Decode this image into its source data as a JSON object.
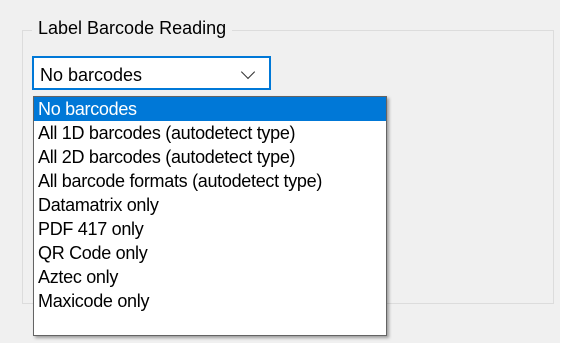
{
  "group": {
    "title": "Label Barcode Reading"
  },
  "combo": {
    "value": "No barcodes"
  },
  "dropdown": {
    "options": [
      "No barcodes",
      "All 1D barcodes (autodetect type)",
      "All 2D barcodes (autodetect type)",
      "All barcode formats (autodetect type)",
      "Datamatrix only",
      "PDF 417 only",
      "QR Code only",
      "Aztec only",
      "Maxicode only"
    ],
    "selected_index": 0
  },
  "colors": {
    "accent": "#0078d7",
    "background": "#f0f0f0"
  }
}
